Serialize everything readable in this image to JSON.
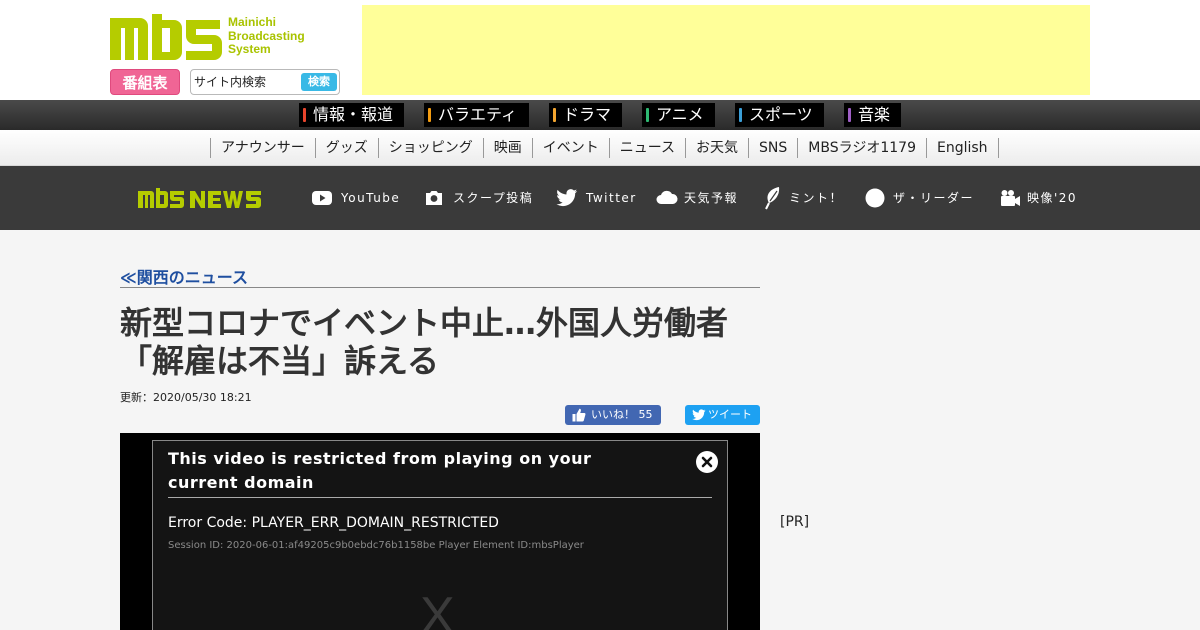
{
  "header": {
    "logo_text_lines": [
      "Mainichi",
      "Broadcasting",
      "System"
    ],
    "bangumi_label": "番組表",
    "search_placeholder": "サイト内検索",
    "search_button": "検索"
  },
  "genre_nav": [
    {
      "label": "情報・報道",
      "color": "#e8452c"
    },
    {
      "label": "バラエティ",
      "color": "#f39c12"
    },
    {
      "label": "ドラマ",
      "color": "#f3a530"
    },
    {
      "label": "アニメ",
      "color": "#2eb872"
    },
    {
      "label": "スポーツ",
      "color": "#3b9fd8"
    },
    {
      "label": "音楽",
      "color": "#a05fc6"
    }
  ],
  "sub_nav": [
    "アナウンサー",
    "グッズ",
    "ショッピング",
    "映画",
    "イベント",
    "ニュース",
    "お天気",
    "SNS",
    "MBSラジオ1179",
    "English"
  ],
  "news_nav": [
    {
      "label": "YouTube",
      "icon": "youtube-icon"
    },
    {
      "label": "スクープ投稿",
      "icon": "camera-icon"
    },
    {
      "label": "Twitter",
      "icon": "twitter-icon"
    },
    {
      "label": "天気予報",
      "icon": "cloud-icon"
    },
    {
      "label": "ミント！",
      "icon": "mint-leaf-icon"
    },
    {
      "label": "ザ・リーダー",
      "icon": "circle-icon"
    },
    {
      "label": "映像'20",
      "icon": "video-camera-icon"
    }
  ],
  "article": {
    "breadcrumb": "≪関西のニュース",
    "title_line1": "新型コロナでイベント中止…外国人労働者",
    "title_line2": "「解雇は不当」訴える",
    "updated": "更新：2020/05/30 18:21",
    "like_label": "いいね！ 55",
    "tweet_label": "ツイート"
  },
  "video_error": {
    "title": "This video is restricted from playing on your current domain",
    "code": "Error Code: PLAYER_ERR_DOMAIN_RESTRICTED",
    "session": "Session ID: 2020-06-01:af49205c9b0ebdc76b1158be Player Element ID:mbsPlayer",
    "big_x": "X"
  },
  "sidebar": {
    "pr": "[PR]"
  },
  "colors": {
    "brand_green": "#b5cc00",
    "ad_yellow": "#ffff99",
    "bangumi_pink": "#f06595",
    "search_blue": "#39b9e6",
    "link_blue": "#1f4fa0"
  }
}
